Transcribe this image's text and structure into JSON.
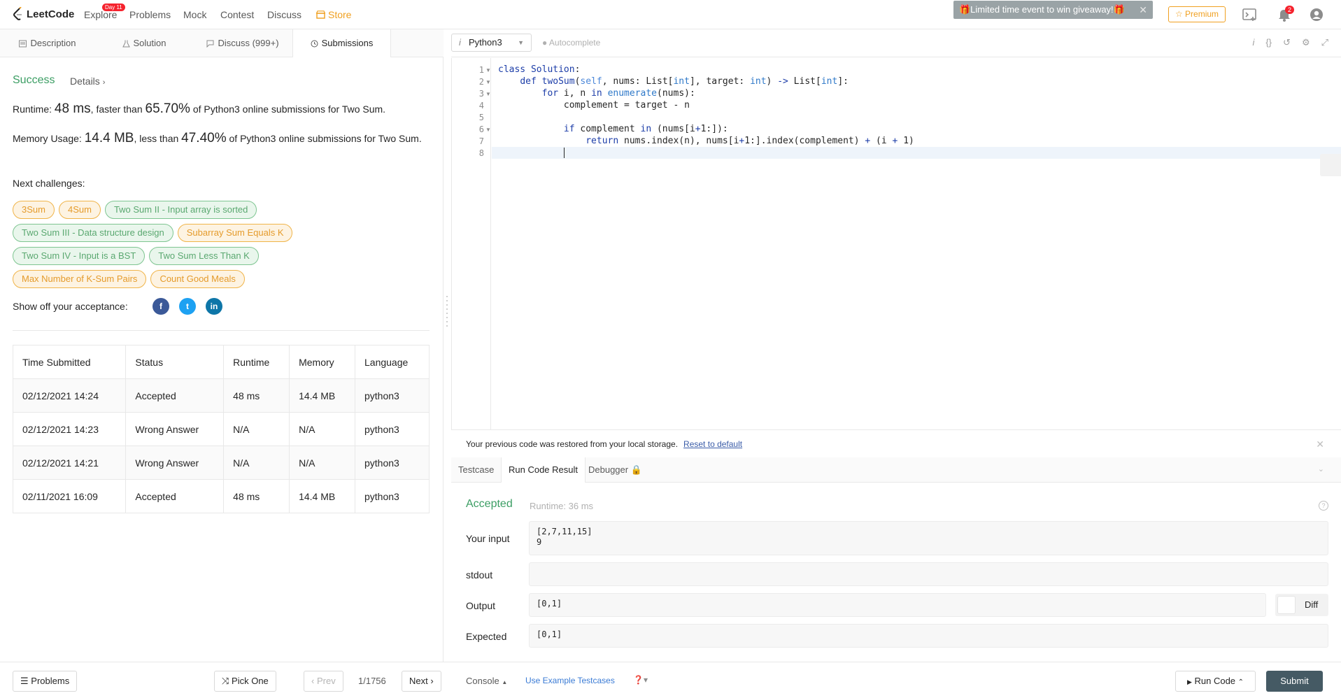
{
  "nav": {
    "logo": "LeetCode",
    "explore": "Explore",
    "day_badge": "Day 11",
    "problems": "Problems",
    "mock": "Mock",
    "contest": "Contest",
    "discuss": "Discuss",
    "store": "Store",
    "giveaway": "🎁Limited time event to win giveaway!🎁",
    "premium": "☆ Premium",
    "notifications_count": "2"
  },
  "left_tabs": [
    "Description",
    "Solution",
    "Discuss (999+)",
    "Submissions"
  ],
  "result": {
    "status": "Success",
    "details": "Details",
    "runtime_label": "Runtime: ",
    "runtime_value": "48 ms",
    "runtime_mid": ", faster than ",
    "runtime_pct": "65.70%",
    "runtime_tail": " of Python3 online submissions for Two Sum.",
    "memory_label": "Memory Usage: ",
    "memory_value": "14.4 MB",
    "memory_mid": ", less than ",
    "memory_pct": "47.40%",
    "memory_tail": " of Python3 online submissions for Two Sum."
  },
  "next_challenges_label": "Next challenges:",
  "challenges": [
    {
      "name": "3Sum",
      "difficulty": "medium"
    },
    {
      "name": "4Sum",
      "difficulty": "medium"
    },
    {
      "name": "Two Sum II - Input array is sorted",
      "difficulty": "easy"
    },
    {
      "name": "Two Sum III - Data structure design",
      "difficulty": "easy"
    },
    {
      "name": "Subarray Sum Equals K",
      "difficulty": "medium"
    },
    {
      "name": "Two Sum IV - Input is a BST",
      "difficulty": "easy"
    },
    {
      "name": "Two Sum Less Than K",
      "difficulty": "easy"
    },
    {
      "name": "Max Number of K-Sum Pairs",
      "difficulty": "medium"
    },
    {
      "name": "Count Good Meals",
      "difficulty": "medium"
    }
  ],
  "share_label": "Show off your acceptance:",
  "submissions": {
    "headers": [
      "Time Submitted",
      "Status",
      "Runtime",
      "Memory",
      "Language"
    ],
    "rows": [
      [
        "02/12/2021 14:24",
        "Accepted",
        "48 ms",
        "14.4 MB",
        "python3"
      ],
      [
        "02/12/2021 14:23",
        "Wrong Answer",
        "N/A",
        "N/A",
        "python3"
      ],
      [
        "02/12/2021 14:21",
        "Wrong Answer",
        "N/A",
        "N/A",
        "python3"
      ],
      [
        "02/11/2021 16:09",
        "Accepted",
        "48 ms",
        "14.4 MB",
        "python3"
      ]
    ]
  },
  "editor": {
    "language": "Python3",
    "autocomplete": "Autocomplete",
    "line_numbers": [
      "1",
      "2",
      "3",
      "4",
      "5",
      "6",
      "7",
      "8"
    ]
  },
  "restored": {
    "message": "Your previous code was restored from your local storage.",
    "reset": "Reset to default"
  },
  "result_tabs": [
    "Testcase",
    "Run Code Result",
    "Debugger"
  ],
  "run_result": {
    "status": "Accepted",
    "runtime": "Runtime: 36 ms",
    "input_label": "Your input",
    "input_line1": "[2,7,11,15]",
    "input_line2": "9",
    "stdout_label": "stdout",
    "stdout": "",
    "output_label": "Output",
    "output": "[0,1]",
    "expected_label": "Expected",
    "expected": "[0,1]",
    "diff": "Diff"
  },
  "bottom": {
    "problems": "Problems",
    "pick_one": "Pick One",
    "prev": "Prev",
    "page": "1/1756",
    "next": "Next",
    "console": "Console",
    "use_example": "Use Example Testcases",
    "run_code": "Run Code",
    "submit": "Submit"
  }
}
